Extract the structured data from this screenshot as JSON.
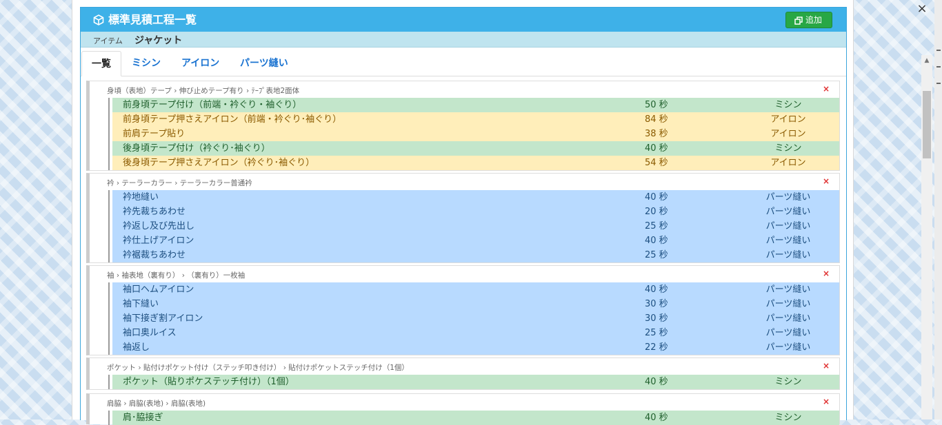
{
  "header": {
    "title": "標準見積工程一覧",
    "add_label": "追加"
  },
  "subheader": {
    "item_label": "アイテム",
    "item_value": "ジャケット"
  },
  "tabs": [
    {
      "label": "一覧"
    },
    {
      "label": "ミシン"
    },
    {
      "label": "アイロン"
    },
    {
      "label": "パーツ縫い"
    }
  ],
  "window": {
    "close_label": "×"
  },
  "colors": {
    "header": "#3eb1e8",
    "add_button": "#28a745",
    "misin": "#c3e6cb",
    "iron": "#ffeeba",
    "parts": "#b8daff",
    "delete": "#e03030"
  },
  "groups": [
    {
      "path": "身頃（表地）テープ › 伸び止めテープ有り › ﾃｰﾌﾟ表地2面体",
      "delete_icon": "×",
      "rows": [
        {
          "name": "前身頃テープ付け（前端・衿ぐり・袖ぐり）",
          "sec": "50 秒",
          "type": "ミシン"
        },
        {
          "name": "前身頃テープ押さえアイロン（前端・衿ぐり･袖ぐり）",
          "sec": "84 秒",
          "type": "アイロン"
        },
        {
          "name": "前肩テープ貼り",
          "sec": "38 秒",
          "type": "アイロン"
        },
        {
          "name": "後身頃テープ付け（衿ぐり･袖ぐり）",
          "sec": "40 秒",
          "type": "ミシン"
        },
        {
          "name": "後身頃テープ押さえアイロン（衿ぐり･袖ぐり）",
          "sec": "54 秒",
          "type": "アイロン"
        }
      ]
    },
    {
      "path": "衿 › テーラーカラー › テーラーカラー普通衿",
      "delete_icon": "×",
      "rows": [
        {
          "name": "衿地縫い",
          "sec": "40 秒",
          "type": "パーツ縫い"
        },
        {
          "name": "衿先裁ちあわせ",
          "sec": "20 秒",
          "type": "パーツ縫い"
        },
        {
          "name": "衿返し及び先出し",
          "sec": "25 秒",
          "type": "パーツ縫い"
        },
        {
          "name": "衿仕上げアイロン",
          "sec": "40 秒",
          "type": "パーツ縫い"
        },
        {
          "name": "衿裾裁ちあわせ",
          "sec": "25 秒",
          "type": "パーツ縫い"
        }
      ]
    },
    {
      "path": "袖 › 袖表地（裏有り） › （裏有り）一枚袖",
      "delete_icon": "×",
      "rows": [
        {
          "name": "袖口ヘムアイロン",
          "sec": "40 秒",
          "type": "パーツ縫い"
        },
        {
          "name": "袖下縫い",
          "sec": "30 秒",
          "type": "パーツ縫い"
        },
        {
          "name": "袖下接ぎ割アイロン",
          "sec": "30 秒",
          "type": "パーツ縫い"
        },
        {
          "name": "袖口奥ルイス",
          "sec": "25 秒",
          "type": "パーツ縫い"
        },
        {
          "name": "袖返し",
          "sec": "22 秒",
          "type": "パーツ縫い"
        }
      ]
    },
    {
      "path": "ポケット › 貼付けポケット付け（ステッチ叩き付け） › 貼付けポケットステッチ付け（1個）",
      "delete_icon": "×",
      "rows": [
        {
          "name": "ポケット（貼りポケステッチ付け）（1個）",
          "sec": "40 秒",
          "type": "ミシン"
        }
      ]
    },
    {
      "path": "肩脇 › 肩脇(表地) › 肩脇(表地)",
      "delete_icon": "×",
      "rows": [
        {
          "name": "肩･脇接ぎ",
          "sec": "40 秒",
          "type": "ミシン"
        }
      ]
    }
  ]
}
